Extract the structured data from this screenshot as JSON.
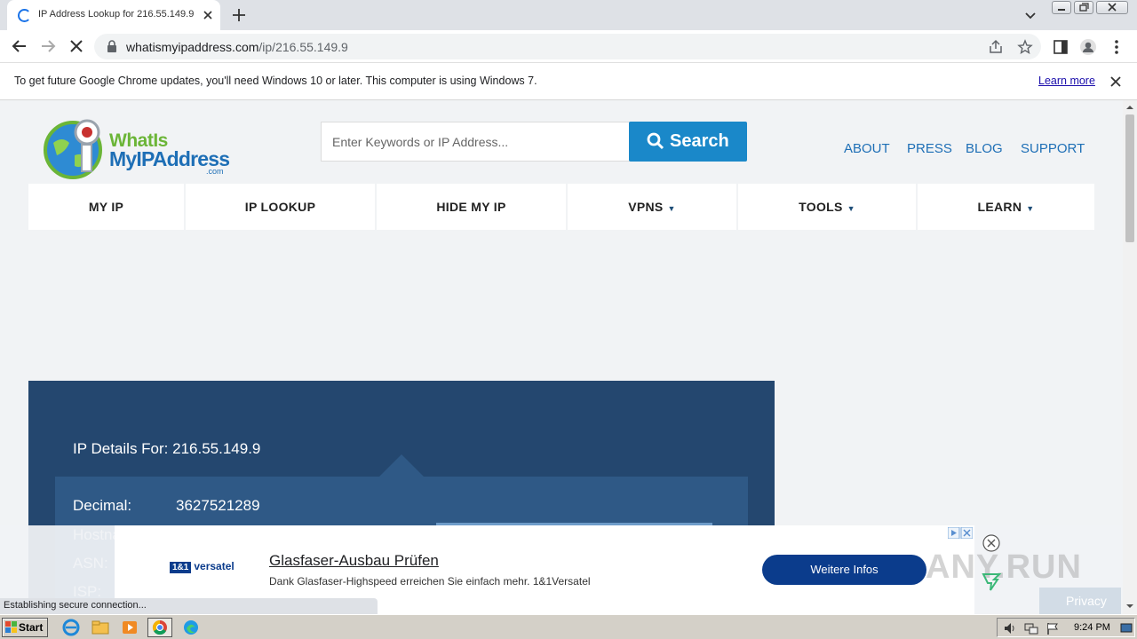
{
  "browser": {
    "tab_title": "IP Address Lookup for 216.55.149.9",
    "url_host": "whatismyipaddress.com",
    "url_path": "/ip/216.55.149.9"
  },
  "infobar": {
    "message": "To get future Google Chrome updates, you'll need Windows 10 or later. This computer is using Windows 7.",
    "learn_more": "Learn more"
  },
  "site": {
    "logo_line1": "WhatIs",
    "logo_line2": "MyIPAddress",
    "logo_suffix": ".com",
    "search_placeholder": "Enter Keywords or IP Address...",
    "search_button": "Search",
    "top_links": [
      "ABOUT",
      "PRESS",
      "BLOG",
      "SUPPORT"
    ],
    "nav": [
      {
        "label": "MY IP",
        "dropdown": false
      },
      {
        "label": "IP LOOKUP",
        "dropdown": false
      },
      {
        "label": "HIDE MY IP",
        "dropdown": false
      },
      {
        "label": "VPNS",
        "dropdown": true
      },
      {
        "label": "TOOLS",
        "dropdown": true
      },
      {
        "label": "LEARN",
        "dropdown": true
      }
    ],
    "accent_color": "#1a88c9",
    "panel_color": "#24476f"
  },
  "ip_details": {
    "heading": "IP Details For: 216.55.149.9",
    "rows": [
      {
        "key": "Decimal:",
        "value": "3627521289"
      },
      {
        "key": "Hostname:",
        "value": ""
      },
      {
        "key": "ASN:",
        "value": ""
      },
      {
        "key": "ISP:",
        "value": ""
      }
    ]
  },
  "ad": {
    "brand": "1&1 versatel",
    "brand_mark": "1&1",
    "brand_name": "versatel",
    "title": "Glasfaser-Ausbau Prüfen",
    "text": "Dank Glasfaser-Highspeed erreichen Sie einfach mehr. 1&1Versatel",
    "cta": "Weitere Infos",
    "watermark": "ANY.RUN",
    "privacy": "Privacy"
  },
  "status": {
    "text": "Establishing secure connection..."
  },
  "taskbar": {
    "start": "Start",
    "clock": "9:24 PM"
  }
}
